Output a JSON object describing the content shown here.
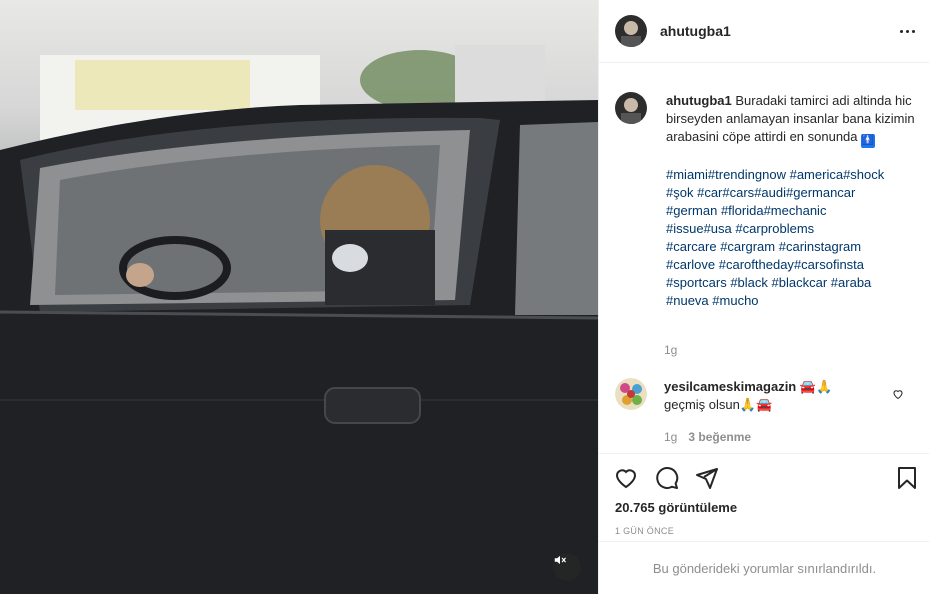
{
  "post": {
    "username": "ahutugba1",
    "caption": "Buradaki tamirci adi altinda hic birseyden anlamayan insanlar bana kizimin arabasini cöpe attirdi en sonunda",
    "caption_emoji": "🚹",
    "hashtags": [
      "#miami",
      "#trendingnow",
      "#america",
      "#shock",
      "#şok",
      "#car",
      "#cars",
      "#audi",
      "#germancar",
      "#german",
      "#florida",
      "#mechanic",
      "#issue",
      "#usa",
      "#carproblems",
      "#carcare",
      "#cargram",
      "#carinstagram",
      "#carlove",
      "#caroftheday",
      "#carsofinsta",
      "#sportcars",
      "#black",
      "#blackcar",
      "#araba",
      "#nueva",
      "#mucho"
    ],
    "caption_time": "1g",
    "views": "20.765 görüntüleme",
    "posted_ago": "1 GÜN ÖNCE",
    "comments_notice": "Bu gönderideki yorumlar sınırlandırıldı."
  },
  "comment": {
    "username": "yesilcameskimagazin",
    "head_emoji": "🚘🙏",
    "text": "geçmiş olsun",
    "text_emoji": "🙏🚘",
    "time": "1g",
    "likes": "3 beğenme"
  },
  "icons": {
    "more": "more-options-icon",
    "like": "heart-icon",
    "comment": "comment-icon",
    "share": "share-icon",
    "save": "bookmark-icon",
    "mute": "speaker-muted-icon"
  }
}
